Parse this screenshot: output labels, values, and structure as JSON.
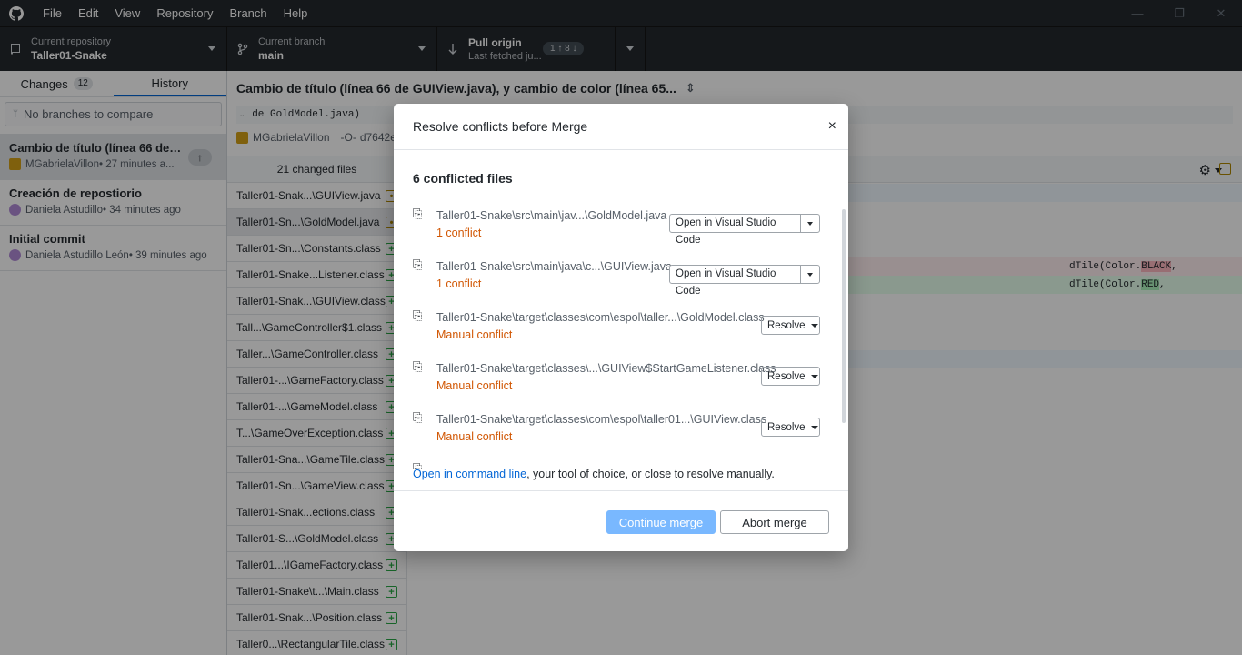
{
  "menu": [
    "File",
    "Edit",
    "View",
    "Repository",
    "Branch",
    "Help"
  ],
  "window_controls": {
    "minimize": "—",
    "restore": "❐",
    "close": "✕"
  },
  "toolbar": {
    "repo_label": "Current repository",
    "repo_value": "Taller01-Snake",
    "branch_label": "Current branch",
    "branch_value": "main",
    "pull_label": "Pull origin",
    "pull_sub": "Last fetched ju...",
    "pull_badge": "1 ↑ 8 ↓"
  },
  "sidebar": {
    "tabs": {
      "changes": "Changes",
      "changes_count": "12",
      "history": "History"
    },
    "compare_placeholder": "No branches to compare",
    "commits": [
      {
        "title": "Cambio de título (línea 66 de G...",
        "author": "MGabrielaVillon",
        "time": " • 27 minutes a..."
      },
      {
        "title": "Creación de repostiorio",
        "author": "Daniela Astudillo",
        "time": " • 34 minutes ago"
      },
      {
        "title": "Initial commit",
        "author": "Daniela Astudillo León",
        "time": " • 39 minutes ago"
      }
    ],
    "push_icon": "↑"
  },
  "main": {
    "commit_title": "Cambio de título (línea 66 de GUIView.java), y cambio de color (línea 65...",
    "commit_desc": "… de GoldModel.java)",
    "author": "MGabrielaVillon",
    "sha": "d7642ea",
    "changed_files": "21 changed files",
    "files": [
      "Taller01-Snak...\\GUIView.java",
      "Taller01-Sn...\\GoldModel.java",
      "Taller01-Sn...\\Constants.class",
      "Taller01-Snake...Listener.class",
      "Taller01-Snak...\\GUIView.class",
      "Tall...\\GameController$1.class",
      "Taller...\\GameController.class",
      "Taller01-...\\GameFactory.class",
      "Taller01-...\\GameModel.class",
      "T...\\GameOverException.class",
      "Taller01-Sna...\\GameTile.class",
      "Taller01-Sn...\\GameView.class",
      "Taller01-Snak...ections.class",
      "Taller01-S...\\GoldModel.class",
      "Taller01...\\IGameFactory.class",
      "Taller01-Snake\\t...\\Main.class",
      "Taller01-Snak...\\Position.class",
      "Taller0...\\RectangularTile.class"
    ],
    "diff": {
      "del_prefix": "dTile(Color.",
      "del_hl": "BLACK",
      "del_suffix": ",",
      "add_prefix": "dTile(Color.",
      "add_hl": "RED",
      "add_suffix": ","
    }
  },
  "dialog": {
    "title": "Resolve conflicts before Merge",
    "close": "×",
    "count_title": "6 conflicted files",
    "files": [
      {
        "path": "Taller01-Snake\\src\\main\\jav...\\GoldModel.java",
        "status": "1 conflict",
        "action": "Open in Visual Studio Code"
      },
      {
        "path": "Taller01-Snake\\src\\main\\java\\c...\\GUIView.java",
        "status": "1 conflict",
        "action": "Open in Visual Studio Code"
      },
      {
        "path": "Taller01-Snake\\target\\classes\\com\\espol\\taller...\\GoldModel.class",
        "status": "Manual conflict",
        "action": "Resolve"
      },
      {
        "path": "Taller01-Snake\\target\\classes\\...\\GUIView$StartGameListener.class",
        "status": "Manual conflict",
        "action": "Resolve"
      },
      {
        "path": "Taller01-Snake\\target\\classes\\com\\espol\\taller01...\\GUIView.class",
        "status": "Manual conflict",
        "action": "Resolve"
      }
    ],
    "cmd_link": "Open in command line",
    "cmd_rest": ", your tool of choice, or close to resolve manually.",
    "continue": "Continue merge",
    "abort": "Abort merge"
  },
  "colors": {
    "accent": "#0366d6",
    "conflict": "#d15704",
    "primary_disabled": "#79b8ff",
    "added": "#28a745",
    "modified": "#b08800"
  }
}
